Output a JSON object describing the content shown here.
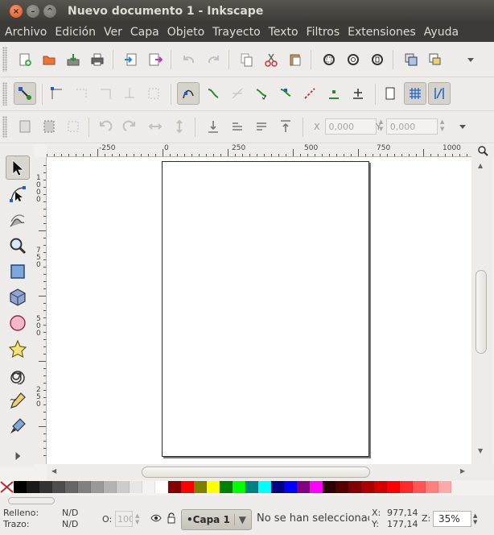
{
  "window": {
    "title": "Nuevo documento 1 - Inkscape",
    "close": "×",
    "minimize": "–",
    "maximize": "^"
  },
  "menu": [
    "Archivo",
    "Edición",
    "Ver",
    "Capa",
    "Objeto",
    "Trayecto",
    "Texto",
    "Filtros",
    "Extensiones",
    "Ayuda"
  ],
  "toolbar3": {
    "x_label": "X",
    "x_value": "0,000",
    "y_label": "Y",
    "y_value": "0,000"
  },
  "ruler_top": [
    "-250",
    "0",
    "250",
    "500",
    "750",
    "1000"
  ],
  "ruler_left": [
    "1000",
    "750",
    "500",
    "250"
  ],
  "colors": {
    "palette": [
      "#000000",
      "#1a1a1a",
      "#333333",
      "#4d4d4d",
      "#666666",
      "#808080",
      "#999999",
      "#b3b3b3",
      "#cccccc",
      "#e6e6e6",
      "#f2f2f2",
      "#ffffff",
      "#800000",
      "#ff0000",
      "#808000",
      "#ffff00",
      "#008000",
      "#00ff00",
      "#008080",
      "#00ffff",
      "#000080",
      "#0000ff",
      "#800080",
      "#ff00ff",
      "#2b0000",
      "#550000",
      "#800000",
      "#aa0000",
      "#d40000",
      "#ff0000",
      "#ff2a2a",
      "#ff5555",
      "#ff8080",
      "#ffaaaa"
    ],
    "accent_blue": "#1f5fc8",
    "accent_green": "#2a8c2a"
  },
  "status": {
    "fill_label": "Relleno:",
    "fill_value": "N/D",
    "stroke_label": "Trazo:",
    "stroke_value": "N/D",
    "opacity_label": "O:",
    "opacity_value": "100",
    "layer": "Capa 1",
    "message": "No se han seleccionado objetos.",
    "x_label": "X:",
    "x_value": "977,14",
    "y_label": "Y:",
    "y_value": "177,14",
    "zoom_label": "Z:",
    "zoom_value": "35%"
  }
}
